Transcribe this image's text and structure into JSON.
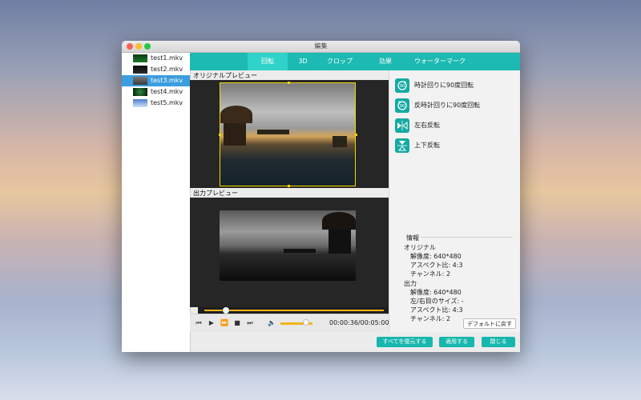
{
  "window": {
    "title": "編集"
  },
  "files": [
    {
      "name": "test1.mkv",
      "selected": false
    },
    {
      "name": "test2.mkv",
      "selected": false
    },
    {
      "name": "test3.mkv",
      "selected": true
    },
    {
      "name": "test4.mkv",
      "selected": false
    },
    {
      "name": "test5.mkv",
      "selected": false
    }
  ],
  "tabs": [
    {
      "label": "回転",
      "active": true
    },
    {
      "label": "3D",
      "active": false
    },
    {
      "label": "クロップ",
      "active": false
    },
    {
      "label": "効果",
      "active": false
    },
    {
      "label": "ウォーターマーク",
      "active": false
    }
  ],
  "preview": {
    "original_label": "オリジナルプレビュー",
    "output_label": "出力プレビュー"
  },
  "playback": {
    "progress_fraction": 0.12,
    "volume_fraction": 0.8,
    "time_text": "00:00:36/00:05:00"
  },
  "rotate": {
    "cw": "時計回りに90度回転",
    "ccw": "反時計回りに90度回転",
    "flip_h": "左右反転",
    "flip_v": "上下反転"
  },
  "info": {
    "title": "情報",
    "original_title": "オリジナル",
    "original_resolution": "解像度: 640*480",
    "original_aspect": "アスペクト比: 4:3",
    "original_channels": "チャンネル: 2",
    "output_title": "出力",
    "output_resolution": "解像度: 640*480",
    "output_margin": "左/右目のサイズ: -",
    "output_aspect": "アスペクト比: 4:3",
    "output_channels": "チャンネル: 2"
  },
  "buttons": {
    "default": "デフォルトに戻す",
    "restore_all": "すべてを復元する",
    "apply": "適用する",
    "close": "閉じる"
  },
  "colors": {
    "accent": "#1cbab2",
    "selection": "#3c9ddf",
    "progress": "#f2b418"
  }
}
